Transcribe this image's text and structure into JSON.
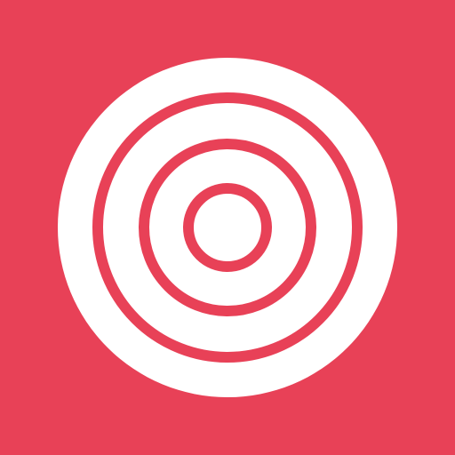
{
  "icon": {
    "name": "target-icon",
    "colors": {
      "background": "#E84157",
      "foreground": "#FFFFFF"
    }
  }
}
